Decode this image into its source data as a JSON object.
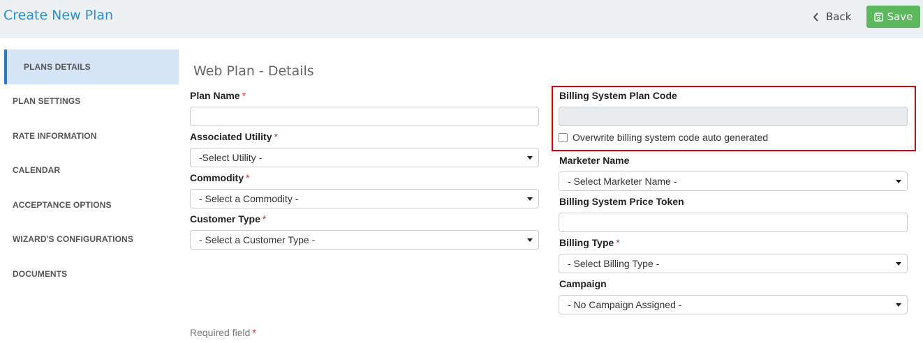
{
  "header": {
    "title": "Create New Plan",
    "back_label": "Back",
    "save_label": "Save"
  },
  "sidebar": {
    "items": [
      {
        "label": "PLANS DETAILS",
        "active": true
      },
      {
        "label": "PLAN SETTINGS"
      },
      {
        "label": "RATE INFORMATION"
      },
      {
        "label": "CALENDAR"
      },
      {
        "label": "ACCEPTANCE OPTIONS"
      },
      {
        "label": "WIZARD'S CONFIGURATIONS"
      },
      {
        "label": "DOCUMENTS"
      }
    ]
  },
  "main": {
    "section_title": "Web Plan - Details",
    "required_marker": "*",
    "left": {
      "plan_name": {
        "label": "Plan Name",
        "value": ""
      },
      "utility": {
        "label": "Associated Utility",
        "selected": "-Select Utility -"
      },
      "commodity": {
        "label": "Commodity",
        "selected": "- Select a Commodity -"
      },
      "customer_type": {
        "label": "Customer Type",
        "selected": "- Select a Customer Type -"
      }
    },
    "right": {
      "billing_code": {
        "label": "Billing System Plan Code",
        "value": ""
      },
      "overwrite_label": "Overwrite billing system code auto generated",
      "marketer": {
        "label": "Marketer Name",
        "selected": "- Select Marketer Name -"
      },
      "price_token": {
        "label": "Billing System Price Token",
        "value": ""
      },
      "billing_type": {
        "label": "Billing Type",
        "selected": "- Select Billing Type -"
      },
      "campaign": {
        "label": "Campaign",
        "selected": "- No Campaign Assigned -"
      }
    },
    "footer_note": "Required field"
  },
  "colors": {
    "accent": "#2b8fd6",
    "save_green": "#5cb85c",
    "highlight": "#d9000d",
    "active_sidebar": "#d5e5f5"
  }
}
